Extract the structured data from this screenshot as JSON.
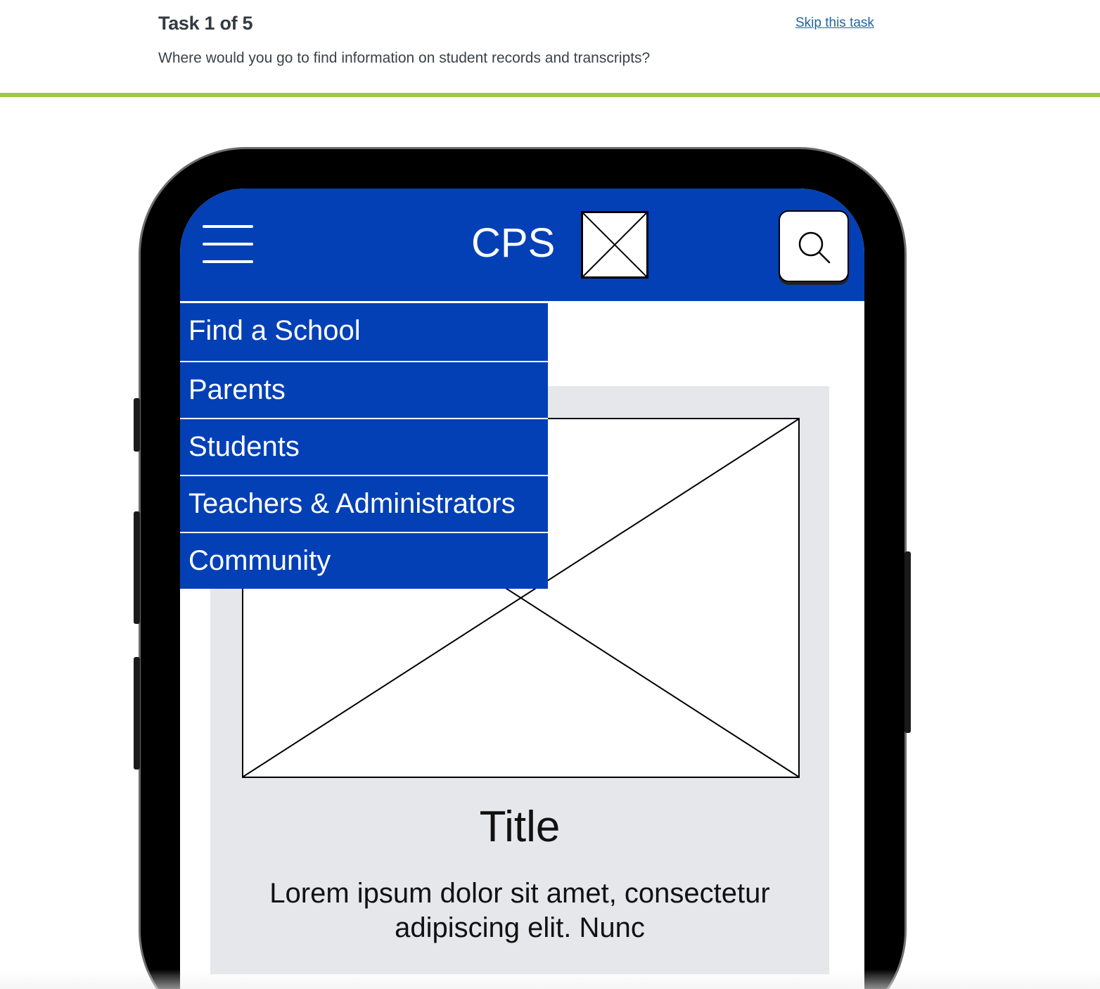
{
  "task": {
    "title": "Task 1 of 5",
    "question": "Where would you go to find information on student records and transcripts?",
    "skip_label": "Skip this task"
  },
  "colors": {
    "progress": "#9dc83f",
    "header_blue": "#0340b6",
    "link": "#1f64a6",
    "card_bg": "#e6e7ea"
  },
  "app": {
    "logo": "CPS",
    "icons": {
      "menu": "hamburger-menu-icon",
      "logo_placeholder": "image-placeholder-icon",
      "search": "search-icon"
    },
    "menu_items": [
      {
        "label": "Find a School"
      },
      {
        "label": "Parents"
      },
      {
        "label": "Students"
      },
      {
        "label": "Teachers & Administrators"
      },
      {
        "label": "Community"
      }
    ],
    "card": {
      "title": "Title",
      "text": "Lorem ipsum dolor sit amet, consectetur adipiscing elit. Nunc"
    }
  }
}
